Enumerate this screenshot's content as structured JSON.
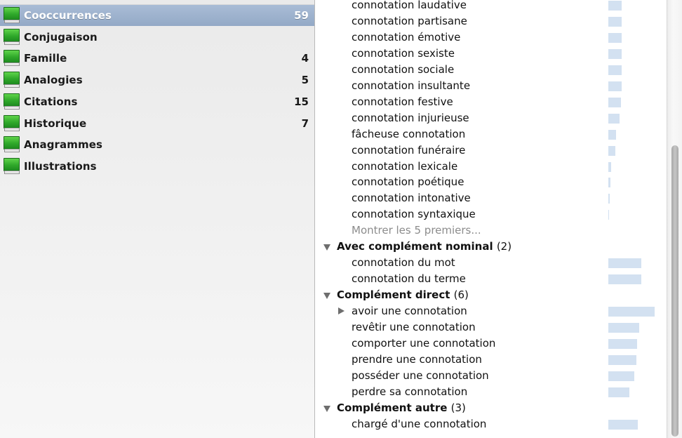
{
  "sidebar": {
    "items": [
      {
        "label": "Cooccurrences",
        "count": "59",
        "selected": true
      },
      {
        "label": "Conjugaison",
        "count": ""
      },
      {
        "label": "Famille",
        "count": "4"
      },
      {
        "label": "Analogies",
        "count": "5"
      },
      {
        "label": "Citations",
        "count": "15"
      },
      {
        "label": "Historique",
        "count": "7"
      },
      {
        "label": "Anagrammes",
        "count": ""
      },
      {
        "label": "Illustrations",
        "count": ""
      }
    ]
  },
  "main": {
    "rows": [
      {
        "kind": "item",
        "text": "connotation laudative",
        "bar": 0.29
      },
      {
        "kind": "item",
        "text": "connotation partisane",
        "bar": 0.29
      },
      {
        "kind": "item",
        "text": "connotation émotive",
        "bar": 0.29
      },
      {
        "kind": "item",
        "text": "connotation sexiste",
        "bar": 0.29
      },
      {
        "kind": "item",
        "text": "connotation sociale",
        "bar": 0.29
      },
      {
        "kind": "item",
        "text": "connotation insultante",
        "bar": 0.29
      },
      {
        "kind": "item",
        "text": "connotation festive",
        "bar": 0.27
      },
      {
        "kind": "item",
        "text": "connotation injurieuse",
        "bar": 0.24
      },
      {
        "kind": "item",
        "text": "fâcheuse connotation",
        "bar": 0.17
      },
      {
        "kind": "item",
        "text": "connotation funéraire",
        "bar": 0.15
      },
      {
        "kind": "item",
        "text": "connotation lexicale",
        "bar": 0.06
      },
      {
        "kind": "item",
        "text": "connotation poétique",
        "bar": 0.05
      },
      {
        "kind": "item",
        "text": "connotation intonative",
        "bar": 0.03
      },
      {
        "kind": "item",
        "text": "connotation syntaxique",
        "bar": 0.02
      },
      {
        "kind": "more",
        "text": "Montrer les 5 premiers..."
      },
      {
        "kind": "header",
        "title": "Avec complément nominal",
        "count": "(2)"
      },
      {
        "kind": "item",
        "text": "connotation du mot",
        "bar": 0.71
      },
      {
        "kind": "item",
        "text": "connotation du terme",
        "bar": 0.71
      },
      {
        "kind": "header",
        "title": "Complément direct",
        "count": "(6)"
      },
      {
        "kind": "item",
        "text": "avoir une connotation",
        "bar": 1.0,
        "expandable": true
      },
      {
        "kind": "item",
        "text": "revêtir une connotation",
        "bar": 0.67
      },
      {
        "kind": "item",
        "text": "comporter une connotation",
        "bar": 0.62
      },
      {
        "kind": "item",
        "text": "prendre une connotation",
        "bar": 0.61
      },
      {
        "kind": "item",
        "text": "posséder une connotation",
        "bar": 0.56
      },
      {
        "kind": "item",
        "text": "perdre sa connotation",
        "bar": 0.45
      },
      {
        "kind": "header",
        "title": "Complément autre",
        "count": "(3)"
      },
      {
        "kind": "item",
        "text": "chargé d'une connotation",
        "bar": 0.64
      }
    ]
  },
  "colors": {
    "selection": "#9fb4d0",
    "bar": "#d3e1f1",
    "book_green": "#2fa82a",
    "muted_text": "#8c8c8c"
  },
  "icons": {
    "sidebar_item": "green-book-icon",
    "section_toggle": "disclosure-triangle-icon"
  }
}
